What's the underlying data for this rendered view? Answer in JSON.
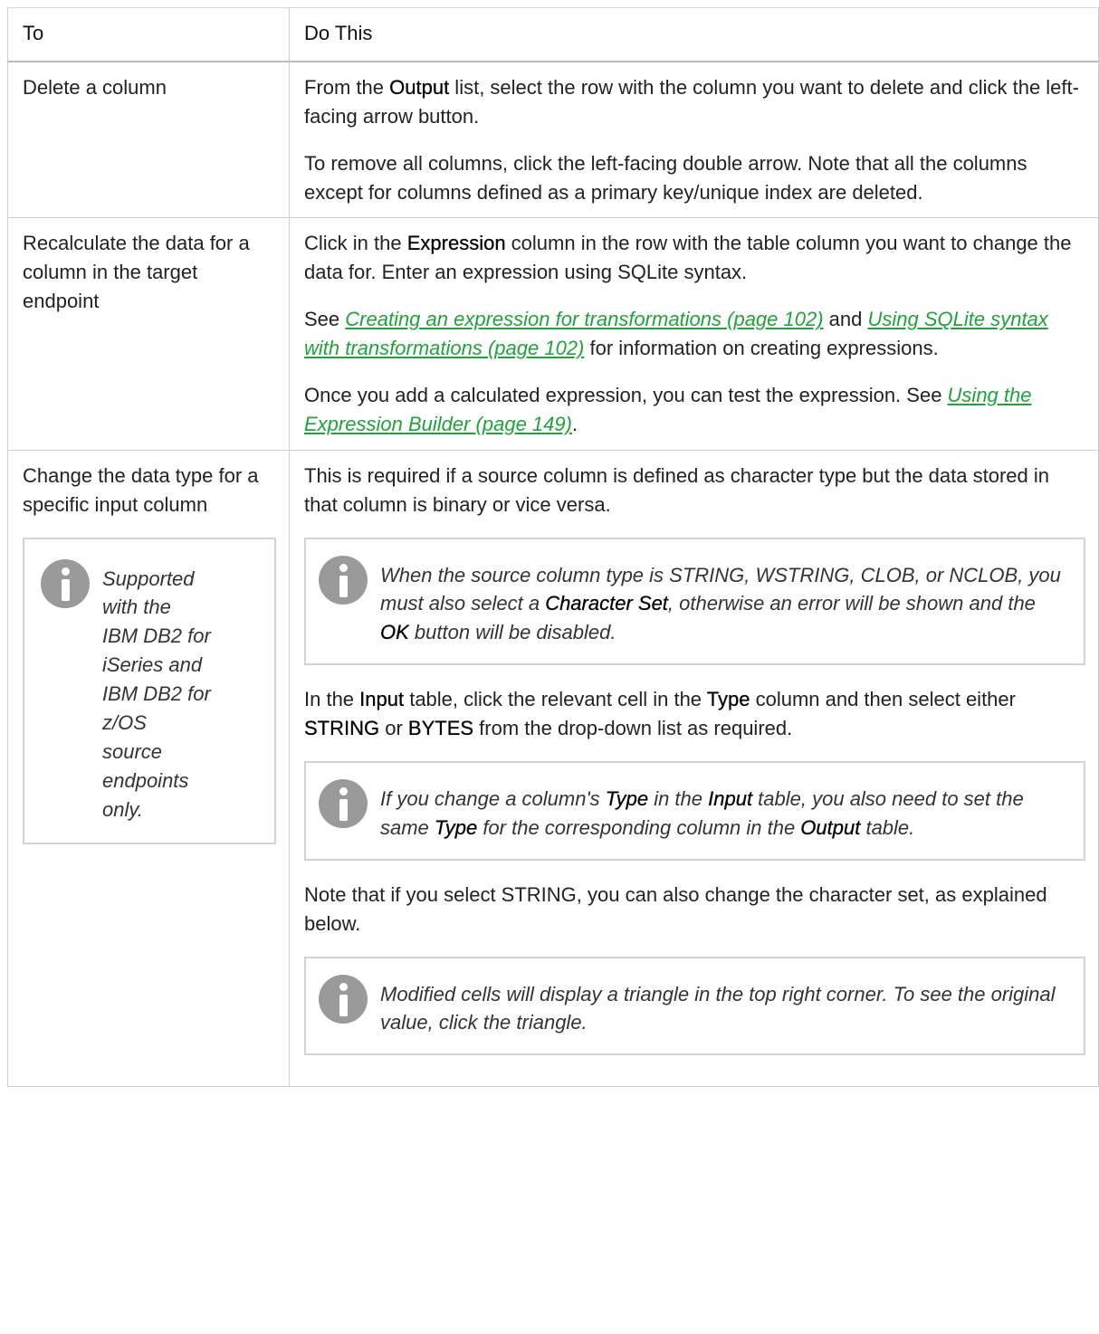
{
  "header": {
    "col1": "To",
    "col2": "Do This"
  },
  "row1": {
    "to": "Delete a column",
    "p1": {
      "a": "From the ",
      "b": "Output",
      "c": " list, select the row with the column you want to delete and click the left-facing arrow button."
    },
    "p2": "To remove all columns, click the left-facing double arrow. Note that all the columns except for columns defined as a primary key/unique index are deleted."
  },
  "row2": {
    "to": "Recalculate the data for a column in the target endpoint",
    "p1": {
      "a": "Click in the ",
      "b": "Expression",
      "c": " column in the row with the table column you want to change the data for. Enter an expression using SQLite syntax."
    },
    "p2": {
      "a": "See ",
      "link1": "Creating an expression for transformations (page 102)",
      "b": " and ",
      "link2": "Using SQLite syntax with transformations (page 102)",
      "c": " for information on creating expressions."
    },
    "p3": {
      "a": "Once you add a calculated expression, you can test the expression. See ",
      "link": "Using the Expression Builder (page 149)",
      "b": "."
    }
  },
  "row3": {
    "to": "Change the data type for a specific input column",
    "side_note": "Supported with the IBM DB2 for iSeries and IBM DB2 for z/OS source endpoints only.",
    "p1": "This is required if a source column is defined as character type but the data stored in that column is binary or vice versa.",
    "note1": {
      "a": "When the source column type is STRING, WSTRING, CLOB, or NCLOB, you must also select a ",
      "b": "Character Set",
      "c": ", otherwise an error will be shown and the ",
      "d": "OK",
      "e": " button will be disabled."
    },
    "p2": {
      "a": "In the ",
      "b": "Input",
      "c": " table, click the relevant cell in the ",
      "d": "Type",
      "e": " column and then select either ",
      "f": "STRING",
      "g": " or ",
      "h": "BYTES",
      "i": " from the drop-down list as required."
    },
    "note2": {
      "a": "If you change a column's ",
      "b": "Type",
      "c": " in the ",
      "d": "Input",
      "e": " table, you also need to set the same ",
      "f": "Type",
      "g": " for the corresponding column in the ",
      "h": "Output",
      "i": " table."
    },
    "p3": "Note that if you select STRING, you can also change the character set, as explained below.",
    "note3": "Modified cells will display a triangle in the top right corner. To see the original value, click the triangle."
  },
  "icons": {
    "info": "info-icon"
  },
  "colors": {
    "link": "#1fa33a",
    "border": "#cfcfcf",
    "icon": "#9a9a9a"
  }
}
